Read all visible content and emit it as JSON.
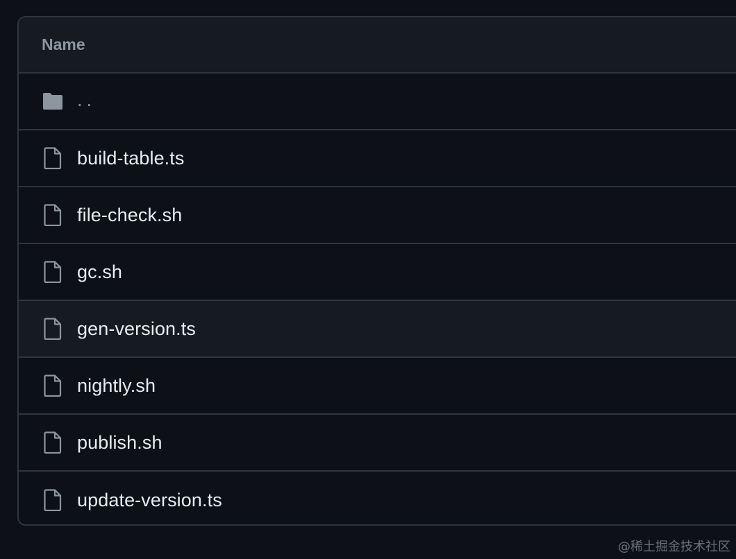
{
  "table": {
    "header_label": "Name",
    "parent_row": {
      "name": "..",
      "icon": "folder-icon"
    },
    "rows": [
      {
        "name": "build-table.ts",
        "icon": "file-icon"
      },
      {
        "name": "file-check.sh",
        "icon": "file-icon"
      },
      {
        "name": "gc.sh",
        "icon": "file-icon"
      },
      {
        "name": "gen-version.ts",
        "icon": "file-icon"
      },
      {
        "name": "nightly.sh",
        "icon": "file-icon"
      },
      {
        "name": "publish.sh",
        "icon": "file-icon"
      },
      {
        "name": "update-version.ts",
        "icon": "file-icon"
      }
    ]
  },
  "colors": {
    "background": "#0d1117",
    "header_bg": "#161b22",
    "hover_bg": "#161b22",
    "border": "#30363d",
    "icon": "#8d96a0",
    "text": "#e6edf3",
    "muted_text": "#8d96a0"
  },
  "watermark": "@稀土掘金技术社区"
}
